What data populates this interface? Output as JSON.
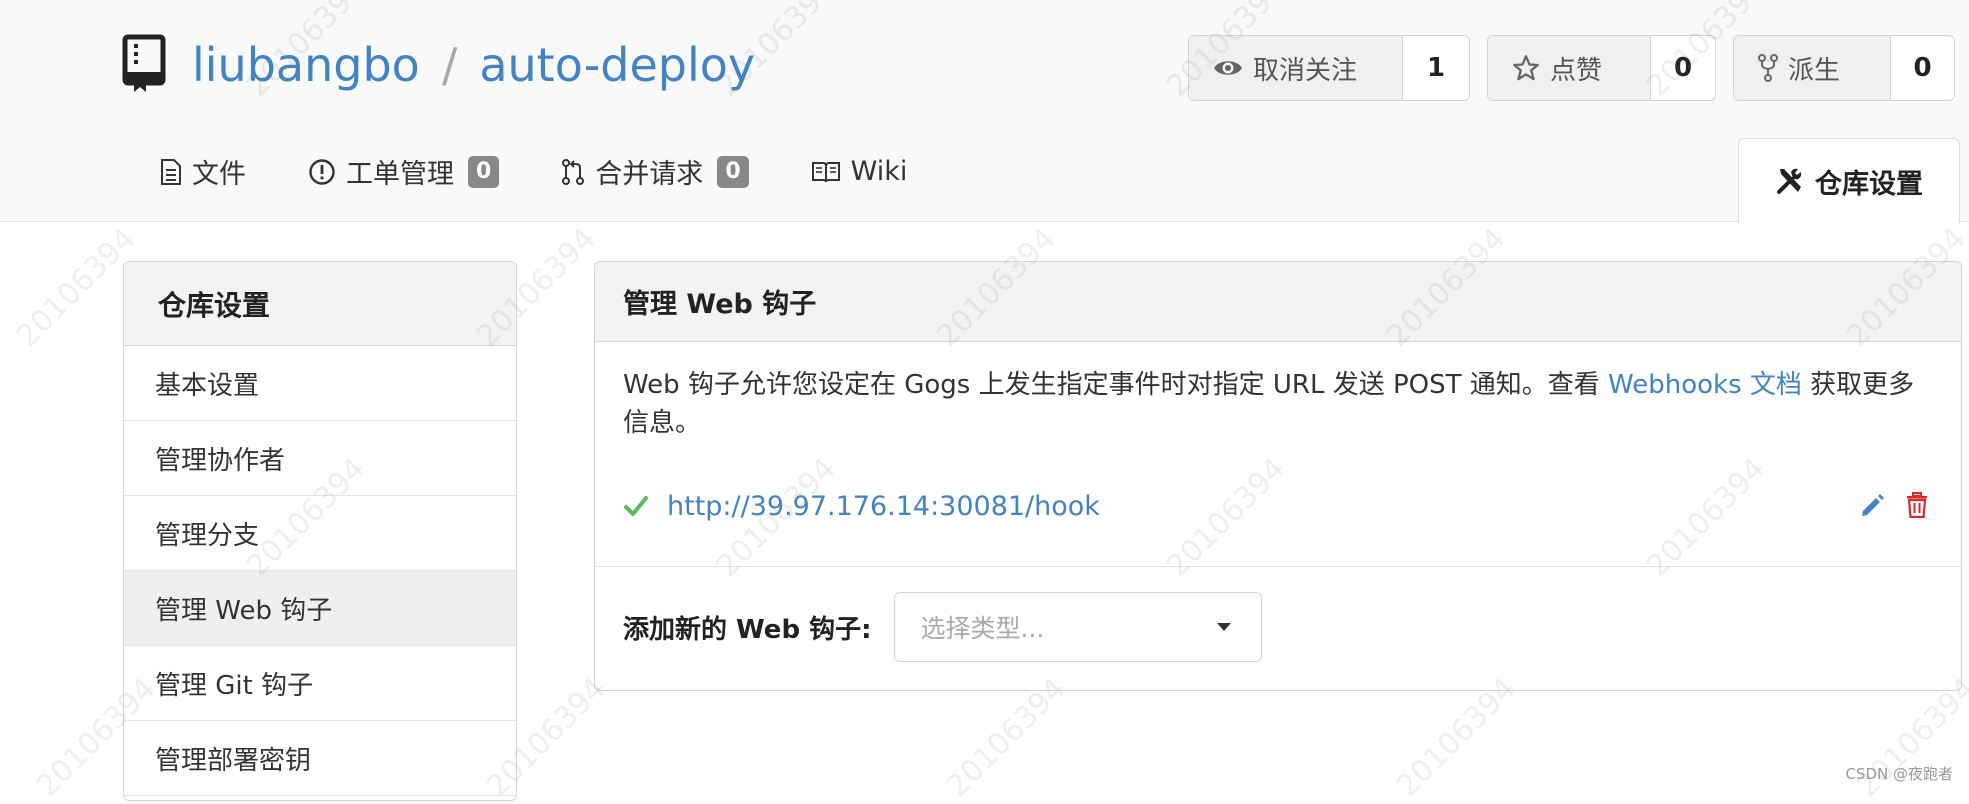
{
  "repo": {
    "owner": "liubangbo",
    "separator": "/",
    "name": "auto-deploy"
  },
  "stats": {
    "watch": {
      "label": "取消关注",
      "count": "1"
    },
    "star": {
      "label": "点赞",
      "count": "0"
    },
    "fork": {
      "label": "派生",
      "count": "0"
    }
  },
  "tabs": [
    {
      "label": "文件",
      "icon": "file-icon"
    },
    {
      "label": "工单管理",
      "badge": "0",
      "icon": "issue-icon"
    },
    {
      "label": "合并请求",
      "badge": "0",
      "icon": "pull-request-icon"
    },
    {
      "label": "Wiki",
      "icon": "book-icon"
    }
  ],
  "active_tab": {
    "label": "仓库设置",
    "icon": "tools-icon"
  },
  "sidebar": {
    "title": "仓库设置",
    "items": [
      {
        "label": "基本设置"
      },
      {
        "label": "管理协作者"
      },
      {
        "label": "管理分支"
      },
      {
        "label": "管理 Web 钩子",
        "active": true
      },
      {
        "label": "管理 Git 钩子"
      },
      {
        "label": "管理部署密钥"
      }
    ]
  },
  "panel": {
    "title": "管理 Web 钩子",
    "description_before": "Web 钩子允许您设定在 Gogs 上发生指定事件时对指定 URL 发送 POST 通知。查看",
    "description_link": "Webhooks 文档",
    "description_after": "获取更多信息。",
    "hook_url": "http://39.97.176.14:30081/hook",
    "add_label": "添加新的 Web 钩子:",
    "select_placeholder": "选择类型..."
  },
  "watermark_text": "20106394",
  "credit": "CSDN @夜跑者",
  "colors": {
    "link": "#4183c4",
    "success": "#5cb85c",
    "danger": "#db2828"
  }
}
